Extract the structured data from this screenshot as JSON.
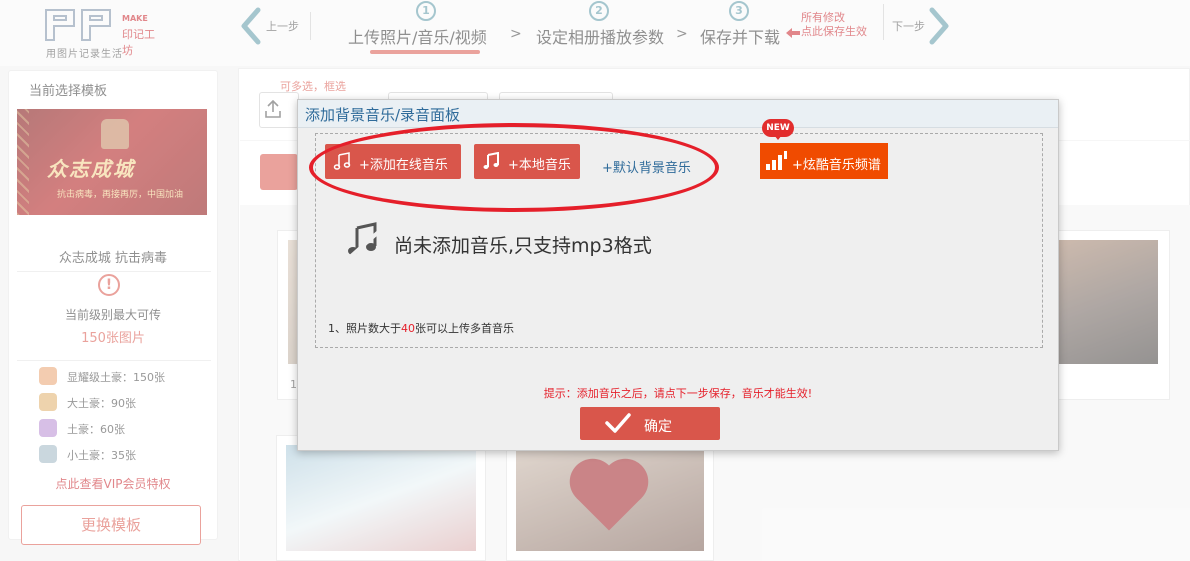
{
  "header": {
    "logo": {
      "make": "MAKE",
      "yinji": "印记工坊",
      "slogan": "用图片记录生活"
    },
    "prev_step_label": "上一步",
    "next_step_label": "下一步",
    "steps": [
      {
        "number": "1",
        "label": "上传照片/音乐/视频"
      },
      {
        "number": "2",
        "label": "设定相册播放参数"
      },
      {
        "number": "3",
        "label": "保存并下载"
      }
    ],
    "step_separator": ">",
    "save_note": {
      "line1": "所有修改",
      "line2": "点此保存生效"
    },
    "active_step_color": "#d9564b",
    "accent_color": "#5b97a7"
  },
  "left_panel": {
    "title": "当前选择模板",
    "template_thumb": {
      "big_text": "众志成城",
      "small_text": "抗击病毒，再接再厉，中国加油"
    },
    "template_name": "众志成城 抗击病毒",
    "level_text": "当前级别最大可传",
    "level_count": "150张图片",
    "tiers": [
      {
        "label": "显耀级土豪：150张",
        "color": "#e9a36f"
      },
      {
        "label": "大土豪：90张",
        "color": "#e0b06a"
      },
      {
        "label": "土豪：60张",
        "color": "#b78ad1"
      },
      {
        "label": "小土豪：35张",
        "color": "#9fb6c4"
      }
    ],
    "vip_link": "点此查看VIP会员特权",
    "change_button": "更换模板"
  },
  "right_panel": {
    "multi_select_note": "可多选，框选",
    "photo_number": "1"
  },
  "modal": {
    "title": "添加背景音乐/录音面板",
    "buttons": {
      "add_online": "+添加在线音乐",
      "local": "+本地音乐",
      "default_bg": "+默认背景音乐",
      "kuwo": "+炫酷音乐频谱",
      "new_badge": "NEW"
    },
    "empty_text": "尚未添加音乐,只支持mp3格式",
    "tip": {
      "prefix": "1、照片数大于",
      "number": "40",
      "suffix": "张可以上传多首音乐"
    },
    "hint": "提示：添加音乐之后，请点下一步保存，音乐才能生效!",
    "confirm": "确定",
    "primary_color": "#d9564b",
    "kuwo_color": "#f04b00",
    "annotation_color": "#e51f2a"
  }
}
